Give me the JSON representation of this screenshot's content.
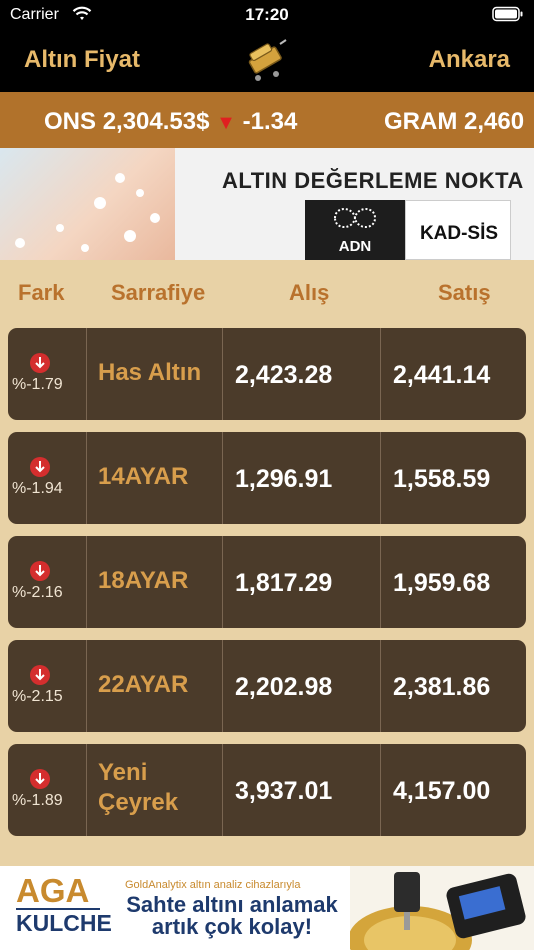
{
  "status": {
    "carrier": "Carrier",
    "time": "17:20"
  },
  "nav": {
    "title": "Altın Fiyat",
    "city": "Ankara"
  },
  "ticker": [
    {
      "label": "ONS",
      "value": "2,304.53",
      "currency": "$",
      "change": "-1.34"
    },
    {
      "label": "GRAM",
      "value": "2,460"
    }
  ],
  "banner": {
    "title": "ALTIN DEĞERLEME NOKTA",
    "brand1": "ADN",
    "brand2": "KAD-SİS"
  },
  "columns": {
    "fark": "Fark",
    "sarrafiye": "Sarrafiye",
    "alis": "Alış",
    "satis": "Satış"
  },
  "rows": [
    {
      "pct": "%-1.79",
      "name": "Has Altın",
      "alis": "2,423.28",
      "satis": "2,441.14"
    },
    {
      "pct": "%-1.94",
      "name": "14AYAR",
      "alis": "1,296.91",
      "satis": "1,558.59"
    },
    {
      "pct": "%-2.16",
      "name": "18AYAR",
      "alis": "1,817.29",
      "satis": "1,959.68"
    },
    {
      "pct": "%-2.15",
      "name": "22AYAR",
      "alis": "2,202.98",
      "satis": "2,381.86"
    },
    {
      "pct": "%-1.89",
      "name": "Yeni Çeyrek",
      "alis": "3,937.01",
      "satis": "4,157.00"
    }
  ],
  "ad": {
    "brand_top": "AGA",
    "brand_bottom": "KULCHE",
    "small": "GoldAnalytix altın analiz cihazlarıyla",
    "line1": "Sahte altını anlamak",
    "line2": "artık çok kolay!"
  },
  "colors": {
    "accent": "#e7b96a",
    "ticker_bg": "#b1722b",
    "row_bg": "#4b3b2a",
    "page_bg": "#e8d2a6",
    "down": "#d42e2e"
  }
}
